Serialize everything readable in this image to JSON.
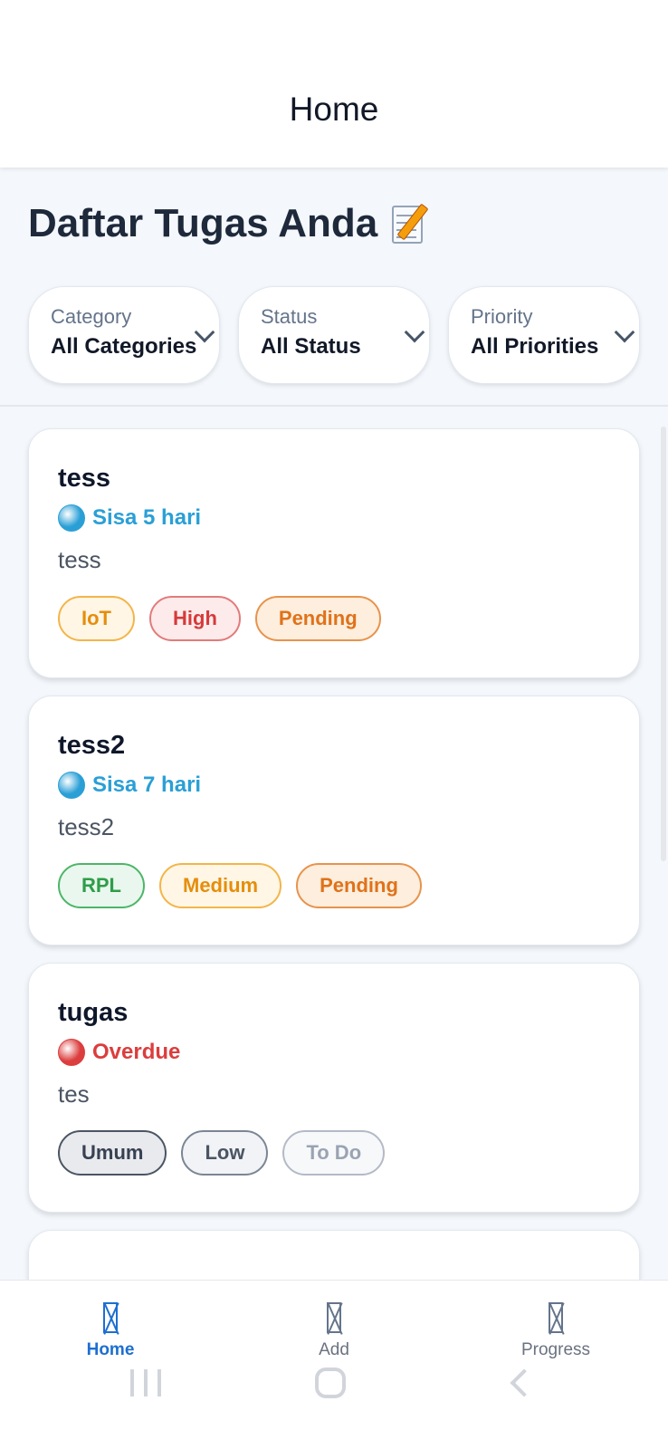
{
  "appbar": {
    "title": "Home"
  },
  "heading": {
    "text": "Daftar Tugas Anda",
    "icon": "memo-pencil-icon"
  },
  "filters": [
    {
      "label": "Category",
      "value": "All Categories"
    },
    {
      "label": "Status",
      "value": "All Status"
    },
    {
      "label": "Priority",
      "value": "All Priorities"
    }
  ],
  "tasks": [
    {
      "title": "tess",
      "due": {
        "indicator": "blue-circle-icon",
        "text": "Sisa 5 hari",
        "color": "#2a9fd6"
      },
      "description": "tess",
      "tags": [
        {
          "text": "IoT",
          "kind": "category",
          "color": "#e58e0c",
          "bg": "#fff6e6",
          "border": "#f3b54a"
        },
        {
          "text": "High",
          "kind": "priority",
          "color": "#d63a3a",
          "bg": "#fdebeb",
          "border": "#e27b7b"
        },
        {
          "text": "Pending",
          "kind": "status",
          "color": "#e0721a",
          "bg": "#fdeedd",
          "border": "#e7934d"
        }
      ]
    },
    {
      "title": "tess2",
      "due": {
        "indicator": "blue-circle-icon",
        "text": "Sisa 7 hari",
        "color": "#2a9fd6"
      },
      "description": "tess2",
      "tags": [
        {
          "text": "RPL",
          "kind": "category",
          "color": "#2e9e49",
          "bg": "#eaf7ee",
          "border": "#4cb668"
        },
        {
          "text": "Medium",
          "kind": "priority",
          "color": "#e58e0c",
          "bg": "#fff6e6",
          "border": "#f3b54a"
        },
        {
          "text": "Pending",
          "kind": "status",
          "color": "#e0721a",
          "bg": "#fdeedd",
          "border": "#e7934d"
        }
      ]
    },
    {
      "title": "tugas",
      "due": {
        "indicator": "red-circle-icon",
        "text": "Overdue",
        "color": "#dc3d3d"
      },
      "description": "tes",
      "tags": [
        {
          "text": "Umum",
          "kind": "category",
          "color": "#374151",
          "bg": "#e8eaee",
          "border": "#4b5563"
        },
        {
          "text": "Low",
          "kind": "priority",
          "color": "#4b5563",
          "bg": "#f1f3f6",
          "border": "#7b8594"
        },
        {
          "text": "To Do",
          "kind": "status",
          "color": "#9aa3b2",
          "bg": "#f7f8fa",
          "border": "#b3bac6"
        }
      ]
    }
  ],
  "bottom_nav": [
    {
      "label": "Home",
      "icon": "missing-glyph-icon",
      "active": true
    },
    {
      "label": "Add",
      "icon": "missing-glyph-icon",
      "active": false
    },
    {
      "label": "Progress",
      "icon": "missing-glyph-icon",
      "active": false
    }
  ],
  "colors": {
    "accent": "#1d6fd1",
    "background": "#f4f7fb"
  }
}
